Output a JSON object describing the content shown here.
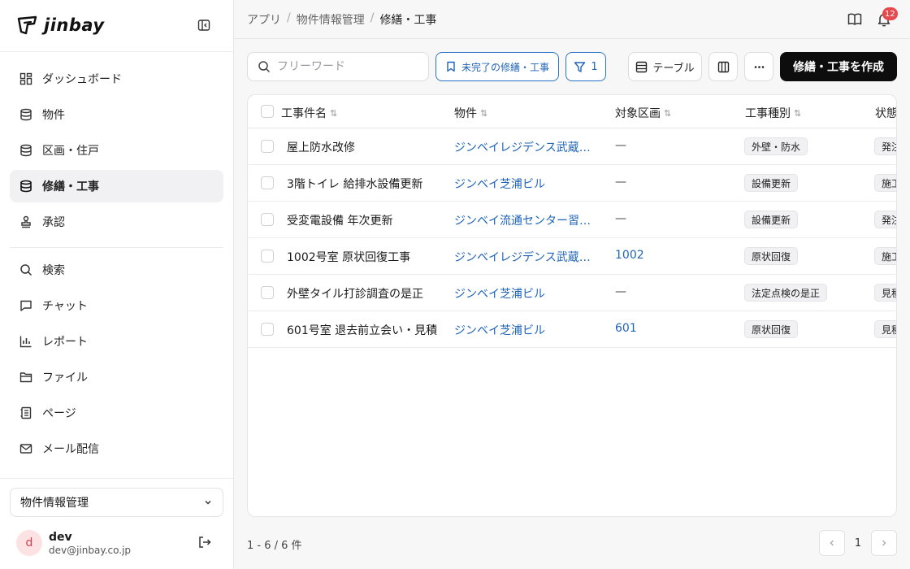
{
  "brand": {
    "name": "jinbay"
  },
  "sidebar": {
    "nav_primary": [
      {
        "label": "ダッシュボード",
        "icon": "dashboard-icon"
      },
      {
        "label": "物件",
        "icon": "database-icon"
      },
      {
        "label": "区画・住戸",
        "icon": "database-icon"
      },
      {
        "label": "修繕・工事",
        "icon": "database-icon",
        "active": true
      },
      {
        "label": "承認",
        "icon": "stamp-icon"
      }
    ],
    "nav_secondary": [
      {
        "label": "検索",
        "icon": "search-icon"
      },
      {
        "label": "チャット",
        "icon": "chat-icon"
      },
      {
        "label": "レポート",
        "icon": "chart-icon"
      },
      {
        "label": "ファイル",
        "icon": "folder-icon"
      },
      {
        "label": "ページ",
        "icon": "page-icon"
      },
      {
        "label": "メール配信",
        "icon": "mail-icon"
      }
    ],
    "workspace": "物件情報管理",
    "user": {
      "initial": "d",
      "name": "dev",
      "email": "dev@jinbay.co.jp"
    }
  },
  "breadcrumb": [
    "アプリ",
    "物件情報管理",
    "修繕・工事"
  ],
  "notifications": {
    "count": "12"
  },
  "toolbar": {
    "search_placeholder": "フリーワード",
    "saved_view_label": "未完了の修繕・工事",
    "filter_count": "1",
    "view_label": "テーブル",
    "create_label": "修繕・工事を作成"
  },
  "table": {
    "columns": [
      "工事件名",
      "物件",
      "対象区画",
      "工事種別",
      "状態"
    ],
    "rows": [
      {
        "name": "屋上防水改修",
        "property": "ジンベイレジデンス武蔵…",
        "unit": "—",
        "type": "外壁・防水",
        "status": "発注"
      },
      {
        "name": "3階トイレ 給排水設備更新",
        "property": "ジンベイ芝浦ビル",
        "unit": "—",
        "type": "設備更新",
        "status": "施工"
      },
      {
        "name": "受変電設備 年次更新",
        "property": "ジンベイ流通センター習…",
        "unit": "—",
        "type": "設備更新",
        "status": "発注"
      },
      {
        "name": "1002号室 原状回復工事",
        "property": "ジンベイレジデンス武蔵…",
        "unit": "1002",
        "type": "原状回復",
        "status": "施工"
      },
      {
        "name": "外壁タイル打診調査の是正",
        "property": "ジンベイ芝浦ビル",
        "unit": "—",
        "type": "法定点検の是正",
        "status": "見積"
      },
      {
        "name": "601号室 退去前立会い・見積",
        "property": "ジンベイ芝浦ビル",
        "unit": "601",
        "type": "原状回復",
        "status": "見積"
      }
    ]
  },
  "footer": {
    "count_label": "1 - 6 / 6 件",
    "current_page": "1"
  }
}
